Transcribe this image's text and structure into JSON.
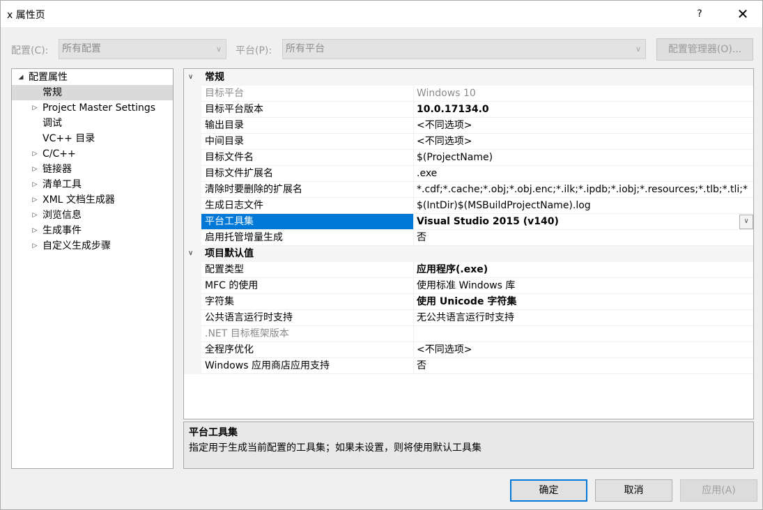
{
  "window": {
    "title": "x 属性页",
    "help": "?",
    "close": "✕"
  },
  "config": {
    "config_label": "配置(C):",
    "config_value": "所有配置",
    "platform_label": "平台(P):",
    "platform_value": "所有平台",
    "manager_label": "配置管理器(O)..."
  },
  "tree": [
    {
      "label": "配置属性",
      "expander": "◢",
      "level": 0,
      "selected": false
    },
    {
      "label": "常规",
      "expander": "",
      "level": 1,
      "selected": true
    },
    {
      "label": "Project Master Settings",
      "expander": "▷",
      "level": 1,
      "selected": false
    },
    {
      "label": "调试",
      "expander": "",
      "level": 1,
      "selected": false
    },
    {
      "label": "VC++ 目录",
      "expander": "",
      "level": 1,
      "selected": false
    },
    {
      "label": "C/C++",
      "expander": "▷",
      "level": 1,
      "selected": false
    },
    {
      "label": "链接器",
      "expander": "▷",
      "level": 1,
      "selected": false
    },
    {
      "label": "清单工具",
      "expander": "▷",
      "level": 1,
      "selected": false
    },
    {
      "label": "XML 文档生成器",
      "expander": "▷",
      "level": 1,
      "selected": false
    },
    {
      "label": "浏览信息",
      "expander": "▷",
      "level": 1,
      "selected": false
    },
    {
      "label": "生成事件",
      "expander": "▷",
      "level": 1,
      "selected": false
    },
    {
      "label": "自定义生成步骤",
      "expander": "▷",
      "level": 1,
      "selected": false
    }
  ],
  "grid": [
    {
      "type": "category",
      "label": "常规",
      "toggle": "∨"
    },
    {
      "type": "prop",
      "name": "目标平台",
      "value": "Windows 10",
      "disabled": true
    },
    {
      "type": "prop",
      "name": "目标平台版本",
      "value": "10.0.17134.0",
      "bold": true
    },
    {
      "type": "prop",
      "name": "输出目录",
      "value": "<不同选项>"
    },
    {
      "type": "prop",
      "name": "中间目录",
      "value": "<不同选项>"
    },
    {
      "type": "prop",
      "name": "目标文件名",
      "value": "$(ProjectName)"
    },
    {
      "type": "prop",
      "name": "目标文件扩展名",
      "value": ".exe"
    },
    {
      "type": "prop",
      "name": "清除时要删除的扩展名",
      "value": "*.cdf;*.cache;*.obj;*.obj.enc;*.ilk;*.ipdb;*.iobj;*.resources;*.tlb;*.tli;*"
    },
    {
      "type": "prop",
      "name": "生成日志文件",
      "value": "$(IntDir)$(MSBuildProjectName).log"
    },
    {
      "type": "prop",
      "name": "平台工具集",
      "value": "Visual Studio 2015 (v140)",
      "bold": true,
      "selected": true,
      "dropdown": "∨"
    },
    {
      "type": "prop",
      "name": "启用托管增量生成",
      "value": "否"
    },
    {
      "type": "category",
      "label": "项目默认值",
      "toggle": "∨"
    },
    {
      "type": "prop",
      "name": "配置类型",
      "value": "应用程序(.exe)",
      "bold": true
    },
    {
      "type": "prop",
      "name": "MFC 的使用",
      "value": "使用标准 Windows 库"
    },
    {
      "type": "prop",
      "name": "字符集",
      "value": "使用 Unicode 字符集",
      "bold": true
    },
    {
      "type": "prop",
      "name": "公共语言运行时支持",
      "value": "无公共语言运行时支持"
    },
    {
      "type": "prop",
      "name": ".NET 目标框架版本",
      "value": "",
      "disabled": true
    },
    {
      "type": "prop",
      "name": "全程序优化",
      "value": "<不同选项>"
    },
    {
      "type": "prop",
      "name": "Windows 应用商店应用支持",
      "value": "否"
    }
  ],
  "description": {
    "title": "平台工具集",
    "text": "指定用于生成当前配置的工具集；如果未设置，则将使用默认工具集"
  },
  "buttons": {
    "ok": "确定",
    "cancel": "取消",
    "apply": "应用(A)"
  },
  "colors": {
    "selection": "#0078d7",
    "tree_selected": "#dadada"
  }
}
